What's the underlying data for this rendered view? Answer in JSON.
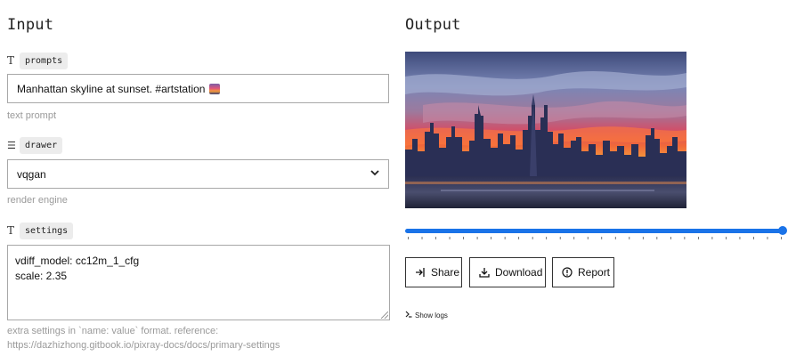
{
  "input": {
    "title": "Input",
    "prompts": {
      "label": "prompts",
      "icon": "text-type-icon",
      "value": "Manhattan skyline at sunset. #artstation",
      "hint": "text prompt"
    },
    "drawer": {
      "label": "drawer",
      "icon": "list-icon",
      "selected": "vqgan",
      "hint": "render engine"
    },
    "settings": {
      "label": "settings",
      "icon": "text-type-icon",
      "line1": "vdiff_model: cc12m_1_cfg",
      "line2": "scale: 2.35",
      "hint_line1": "extra settings in `name: value` format. reference:",
      "hint_line2": "https://dazhizhong.gitbook.io/pixray-docs/docs/primary-settings"
    }
  },
  "output": {
    "title": "Output",
    "slider": {
      "value_fraction": 1.0,
      "tick_count": 28
    },
    "buttons": {
      "share": "Share",
      "download": "Download",
      "report": "Report"
    },
    "show_logs": "Show logs"
  },
  "colors": {
    "accent": "#1a73e8",
    "border": "#a8a8a8",
    "hint": "#9a9a9a"
  }
}
